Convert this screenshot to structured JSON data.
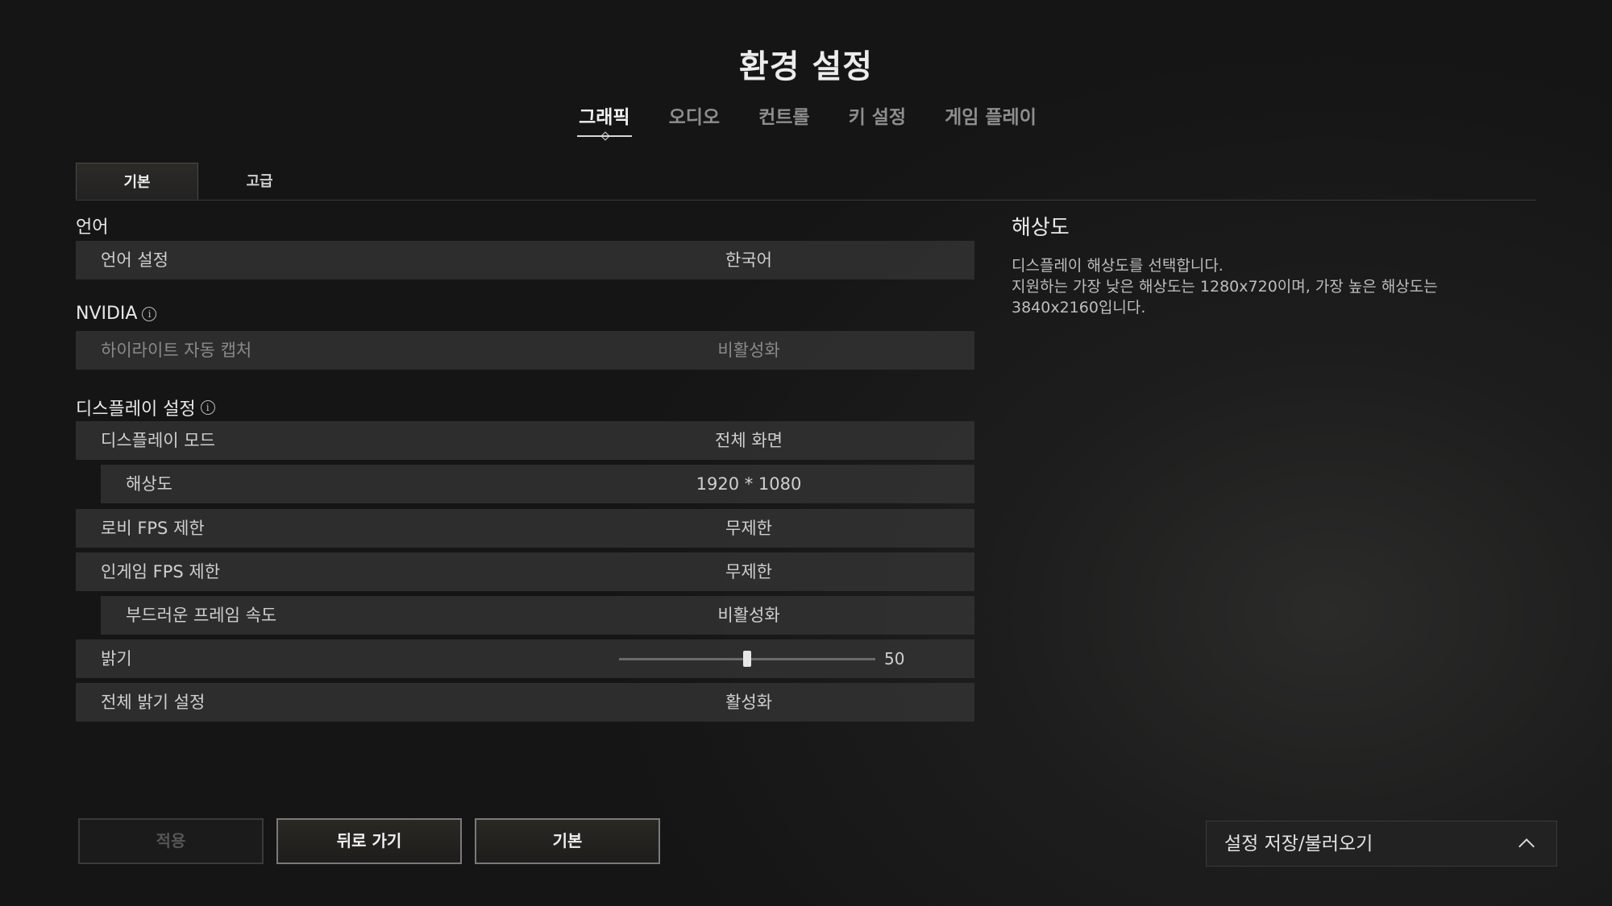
{
  "header": {
    "title": "환경 설정"
  },
  "tabs": [
    {
      "label": "그래픽",
      "active": true
    },
    {
      "label": "오디오"
    },
    {
      "label": "컨트롤"
    },
    {
      "label": "키 설정"
    },
    {
      "label": "게임 플레이"
    }
  ],
  "subtabs": [
    {
      "label": "기본",
      "active": true
    },
    {
      "label": "고급"
    }
  ],
  "sections": {
    "language": "언어",
    "nvidia": "NVIDIA",
    "display": "디스플레이 설정"
  },
  "settings": {
    "language": {
      "label": "언어 설정",
      "value": "한국어"
    },
    "highlight": {
      "label": "하이라이트 자동 캡처",
      "value": "비활성화",
      "disabled": true
    },
    "display_mode": {
      "label": "디스플레이 모드",
      "value": "전체 화면"
    },
    "resolution": {
      "label": "해상도",
      "value": "1920 * 1080"
    },
    "lobby_fps": {
      "label": "로비 FPS 제한",
      "value": "무제한"
    },
    "ingame_fps": {
      "label": "인게임 FPS 제한",
      "value": "무제한"
    },
    "smooth_framerate": {
      "label": "부드러운 프레임 속도",
      "value": "비활성화"
    },
    "brightness": {
      "label": "밝기",
      "value": "50",
      "level": 0.5
    },
    "global_brightness": {
      "label": "전체 밝기 설정",
      "value": "활성화"
    }
  },
  "description": {
    "title": "해상도",
    "line1": "디스플레이 해상도를 선택합니다.",
    "line2": "지원하는 가장 낮은 해상도는 1280x720이며, 가장 높은 해상도는",
    "line3": "3840x2160입니다."
  },
  "buttons": {
    "apply": "적용",
    "back": "뒤로 가기",
    "default": "기본"
  },
  "preset": {
    "label": "설정 저장/불러오기"
  },
  "icons": {
    "info": "info-icon",
    "preset_toggle": "chevron-up-icon"
  }
}
